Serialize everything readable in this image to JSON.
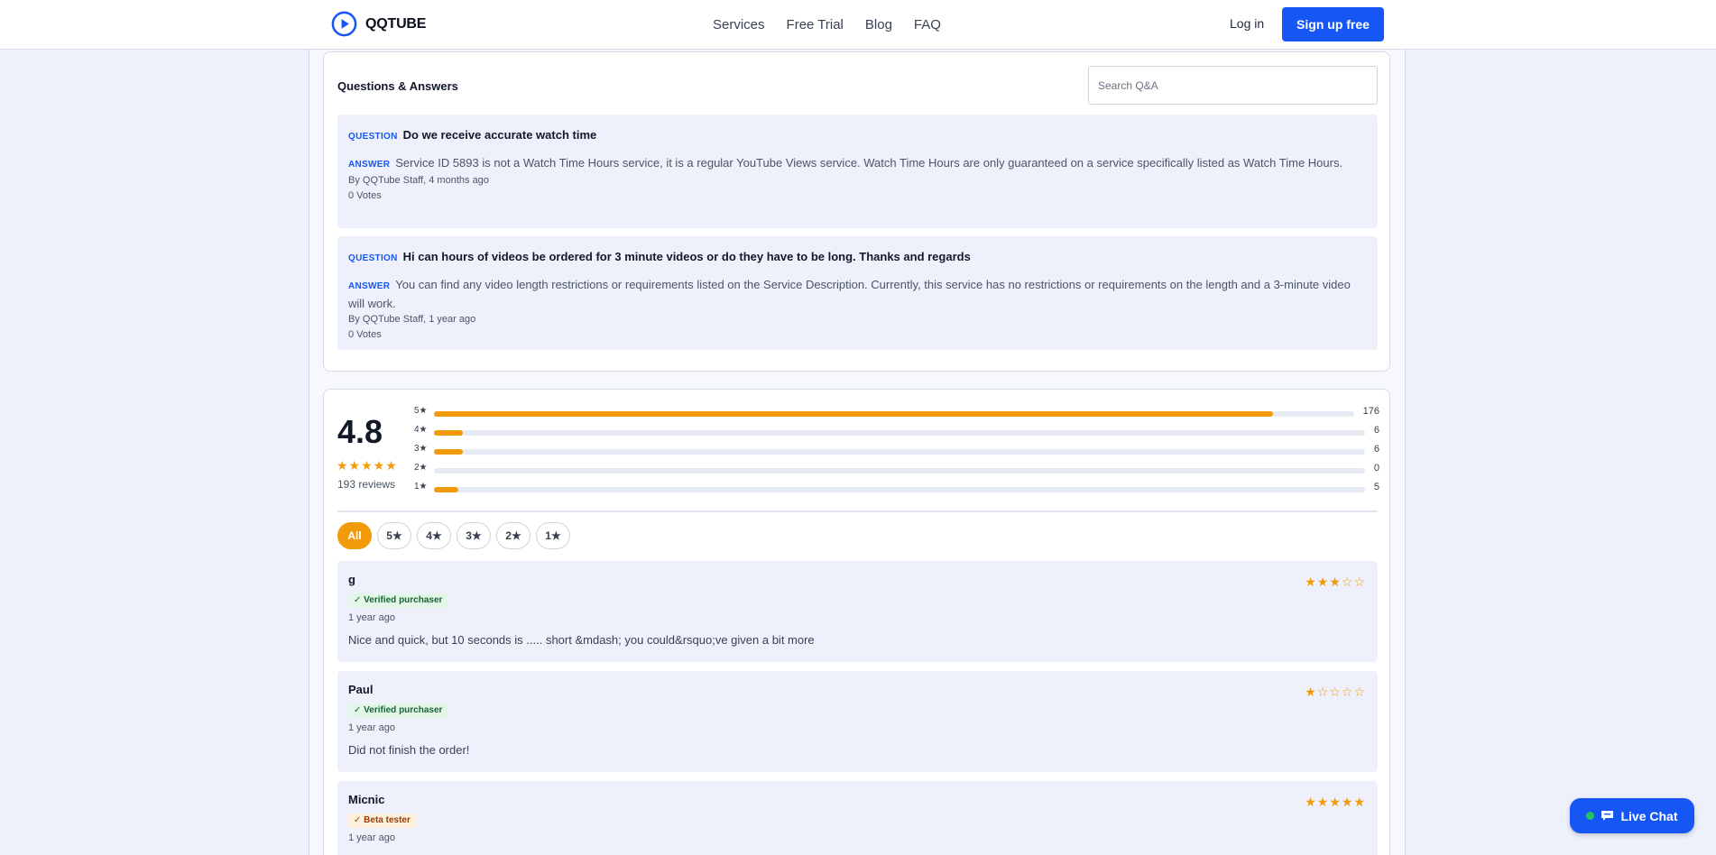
{
  "header": {
    "brand": "QQTUBE",
    "nav": [
      "Services",
      "Free Trial",
      "Blog",
      "FAQ"
    ],
    "login": "Log in",
    "signup": "Sign up free"
  },
  "qa": {
    "title": "Questions & Answers",
    "search_placeholder": "Search Q&A",
    "question_tag": "QUESTION",
    "answer_tag": "ANSWER",
    "items": [
      {
        "question": "Do we receive accurate watch time",
        "answer": "Service ID 5893 is not a Watch Time Hours service, it is a regular YouTube Views service. Watch Time Hours are only guaranteed on a service specifically listed as Watch Time Hours.",
        "byline": "By QQTube Staff, 4 months ago",
        "votes": "0 Votes"
      },
      {
        "question": "Hi can hours of videos be ordered for 3 minute videos or do they have to be long. Thanks and regards",
        "answer": "You can find any video length restrictions or requirements listed on the Service Description. Currently, this service has no restrictions or requirements on the length and a 3-minute video will work.",
        "byline": "By QQTube Staff, 1 year ago",
        "votes": "0 Votes"
      }
    ]
  },
  "reviews": {
    "average": "4.8",
    "average_stars": "★★★★★",
    "count": "193 reviews",
    "breakdown": [
      {
        "label": "5★",
        "count": "176",
        "fraction": 0.912
      },
      {
        "label": "4★",
        "count": "6",
        "fraction": 0.031
      },
      {
        "label": "3★",
        "count": "6",
        "fraction": 0.031
      },
      {
        "label": "2★",
        "count": "0",
        "fraction": 0
      },
      {
        "label": "1★",
        "count": "5",
        "fraction": 0.026
      }
    ],
    "filters": [
      "All",
      "5★",
      "4★",
      "3★",
      "2★",
      "1★"
    ],
    "items": [
      {
        "name": "g",
        "badge": "✓ Verified purchaser",
        "badge_type": "verified",
        "date": "1 year ago",
        "text": "Nice and quick, but 10 seconds is ..... short &mdash; you could&rsquo;ve given a bit more",
        "stars": "★★★☆☆"
      },
      {
        "name": "Paul",
        "badge": "✓ Verified purchaser",
        "badge_type": "verified",
        "date": "1 year ago",
        "text": "Did not finish the order!",
        "stars": "★☆☆☆☆"
      },
      {
        "name": "Micnic",
        "badge": "✓ Beta tester",
        "badge_type": "beta",
        "date": "1 year ago",
        "text": "",
        "stars": "★★★★★"
      }
    ]
  },
  "live_chat": "Live Chat",
  "colors": {
    "accent": "#1556f5",
    "star": "#f29b0a",
    "panel": "#eef1fb"
  }
}
